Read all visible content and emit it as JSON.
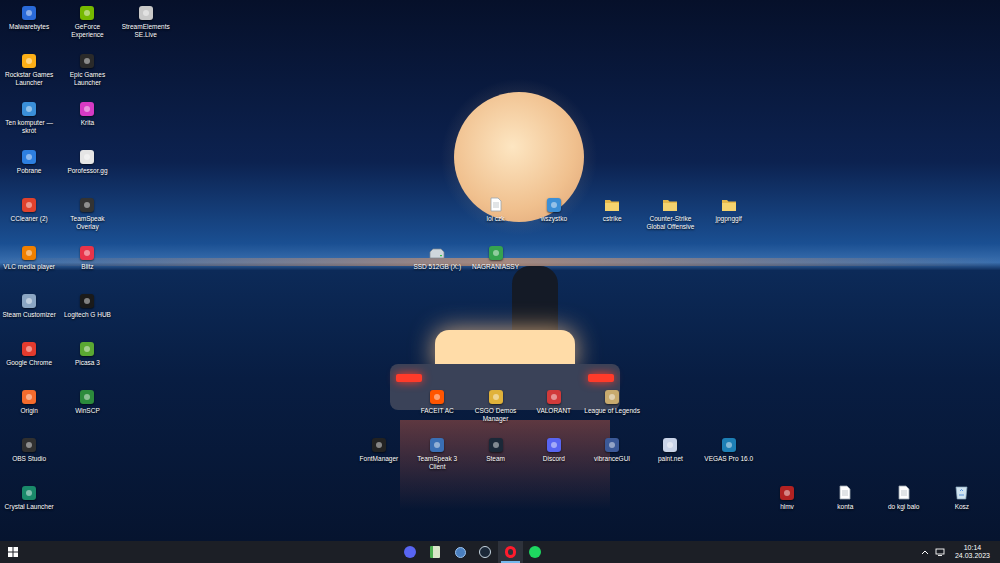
{
  "desktop": {
    "icons": [
      {
        "label": "Malwarebytes",
        "kind": "app"
      },
      {
        "label": "Rockstar Games Launcher",
        "kind": "app"
      },
      {
        "label": "Ten komputer — skrót",
        "kind": "app"
      },
      {
        "label": "Pobrane",
        "kind": "app"
      },
      {
        "label": "CCleaner (2)",
        "kind": "app"
      },
      {
        "label": "VLC media player",
        "kind": "app"
      },
      {
        "label": "Steam Customizer",
        "kind": "app"
      },
      {
        "label": "Google Chrome",
        "kind": "app"
      },
      {
        "label": "Origin",
        "kind": "app"
      },
      {
        "label": "OBS Studio",
        "kind": "app"
      },
      {
        "label": "Crystal Launcher",
        "kind": "app"
      },
      {
        "label": "GeForce Experience",
        "kind": "app"
      },
      {
        "label": "Epic Games Launcher",
        "kind": "app"
      },
      {
        "label": "Krita",
        "kind": "app"
      },
      {
        "label": "Porofessor.gg",
        "kind": "app"
      },
      {
        "label": "TeamSpeak Overlay",
        "kind": "app"
      },
      {
        "label": "Blitz",
        "kind": "app"
      },
      {
        "label": "Logitech G HUB",
        "kind": "app"
      },
      {
        "label": "Picasa 3",
        "kind": "app"
      },
      {
        "label": "WinSCP",
        "kind": "app"
      },
      {
        "label": "StreamElements SE.Live",
        "kind": "app"
      },
      {
        "label": "lol czk",
        "kind": "file"
      },
      {
        "label": "wszystko",
        "kind": "app"
      },
      {
        "label": "cstrike",
        "kind": "folder"
      },
      {
        "label": "Counter-Strike Global Offensive",
        "kind": "folder"
      },
      {
        "label": "jpgpnggif",
        "kind": "folder"
      },
      {
        "label": "SSD 512GB (X:)",
        "kind": "drive"
      },
      {
        "label": "NAGRANIASSY",
        "kind": "app"
      },
      {
        "label": "FACEIT AC",
        "kind": "app"
      },
      {
        "label": "CSGO Demos Manager",
        "kind": "app"
      },
      {
        "label": "VALORANT",
        "kind": "app"
      },
      {
        "label": "League of Legends",
        "kind": "app"
      },
      {
        "label": "FontManager",
        "kind": "app"
      },
      {
        "label": "TeamSpeak 3 Client",
        "kind": "app"
      },
      {
        "label": "Steam",
        "kind": "app"
      },
      {
        "label": "Discord",
        "kind": "app"
      },
      {
        "label": "vibranceGUI",
        "kind": "app"
      },
      {
        "label": "paint.net",
        "kind": "app"
      },
      {
        "label": "VEGAS Pro 16.0",
        "kind": "app"
      },
      {
        "label": "hlmv",
        "kind": "app"
      },
      {
        "label": "konta",
        "kind": "file"
      },
      {
        "label": "do kgi balo",
        "kind": "file"
      },
      {
        "label": "Kosz",
        "kind": "bin"
      }
    ]
  },
  "taskbar": {
    "apps": [
      {
        "kind": "discord",
        "selected": false
      },
      {
        "kind": "notepad",
        "selected": false
      },
      {
        "kind": "drop",
        "selected": false
      },
      {
        "kind": "steam",
        "selected": false
      },
      {
        "kind": "opera",
        "selected": true
      },
      {
        "kind": "spotify",
        "selected": false
      }
    ],
    "tray": {
      "time": "10:14",
      "date": "24.03.2023"
    }
  }
}
